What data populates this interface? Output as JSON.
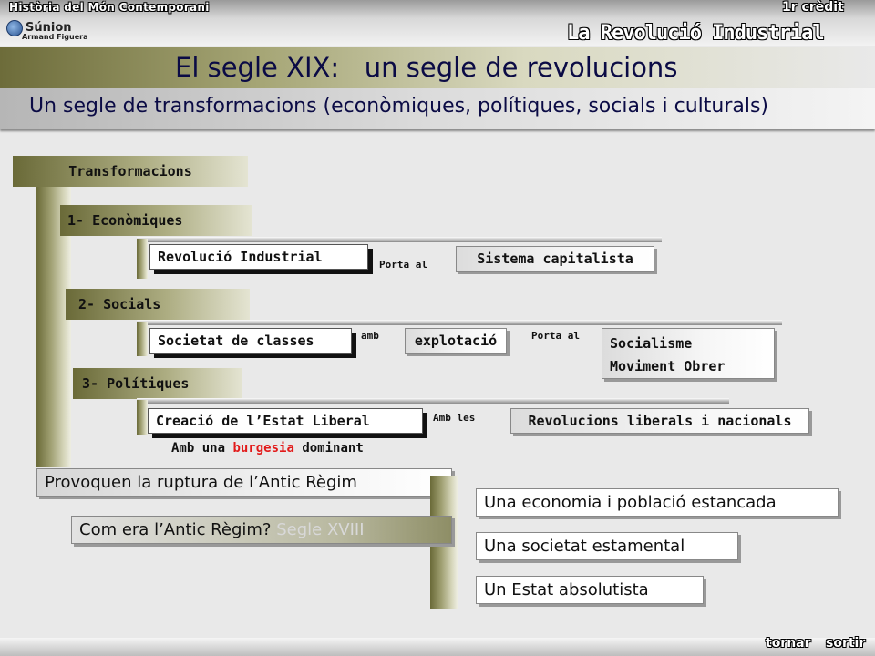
{
  "header": {
    "course": "Història del Món Contemporani",
    "credit": "1r crèdit",
    "unit": "La Revolució Industrial",
    "logo_name": "Súnion",
    "logo_author": "Armand Figuera"
  },
  "title": {
    "part1": "El segle XIX:",
    "part2": "un segle de revolucions"
  },
  "subtitle": "Un segle de transformacions (econòmiques, polítiques, socials i culturals)",
  "diagram": {
    "root": "Transformacions",
    "branches": {
      "economic": {
        "label": "1- Econòmiques",
        "item": "Revolució Industrial",
        "connector": "Porta al",
        "result": "Sistema capitalista"
      },
      "social": {
        "label": "2- Socials",
        "item": "Societat de classes",
        "connector1": "amb",
        "middle": "explotació",
        "connector2": "Porta al",
        "result_line1": "Socialisme",
        "result_line2": "Moviment Obrer"
      },
      "political": {
        "label": "3- Polítiques",
        "item": "Creació de l’Estat Liberal",
        "connector": "Amb les",
        "result": "Revolucions liberals i nacionals",
        "note_prefix": "Amb una",
        "note_highlight": "burgesia",
        "note_suffix": "dominant"
      }
    },
    "rupture": "Provoquen la ruptura de l’Antic Règim",
    "question": "Com era l’Antic Règim?",
    "question_highlight": "Segle XVIII",
    "old_regime": [
      "Una economia i població estancada",
      "Una societat estamental",
      "Un Estat absolutista"
    ]
  },
  "nav": {
    "back": "tornar",
    "exit": "sortir"
  },
  "colors": {
    "title_blue": "#0b0b45",
    "olive": "#6a6a38",
    "highlight_red": "#e21a1a"
  }
}
